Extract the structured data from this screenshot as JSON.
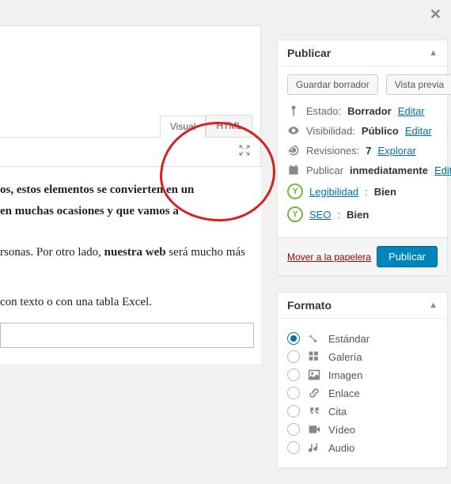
{
  "close_label": "✕",
  "editor": {
    "tab_visual": "Visual",
    "tab_html": "HTML"
  },
  "content": {
    "line1": "os, estos elementos se convierten en un",
    "line2": " en muchas ocasiones y que vamos a",
    "line3a": "rsonas. Por otro lado, ",
    "line3b": "nuestra web",
    "line3c": " será mucho más",
    "line4": "con texto o con una tabla Excel."
  },
  "publish": {
    "title": "Publicar",
    "save_draft": "Guardar borrador",
    "preview": "Vista previa",
    "status_label": "Estado:",
    "status_value": "Borrador",
    "status_edit": "Editar",
    "visibility_label": "Visibilidad:",
    "visibility_value": "Público",
    "visibility_edit": "Editar",
    "revisions_label": "Revisiones:",
    "revisions_value": "7",
    "revisions_link": "Explorar",
    "schedule_label": "Publicar",
    "schedule_value": "inmediatamente",
    "schedule_edit": "Editar",
    "readability_label": "Legibilidad",
    "readability_value": "Bien",
    "seo_label": "SEO",
    "seo_value": "Bien",
    "trash": "Mover a la papelera",
    "publish_btn": "Publicar"
  },
  "format": {
    "title": "Formato",
    "items": [
      {
        "label": "Estándar"
      },
      {
        "label": "Galería"
      },
      {
        "label": "Imagen"
      },
      {
        "label": "Enlace"
      },
      {
        "label": "Cita"
      },
      {
        "label": "Vídeo"
      },
      {
        "label": "Audio"
      }
    ]
  }
}
